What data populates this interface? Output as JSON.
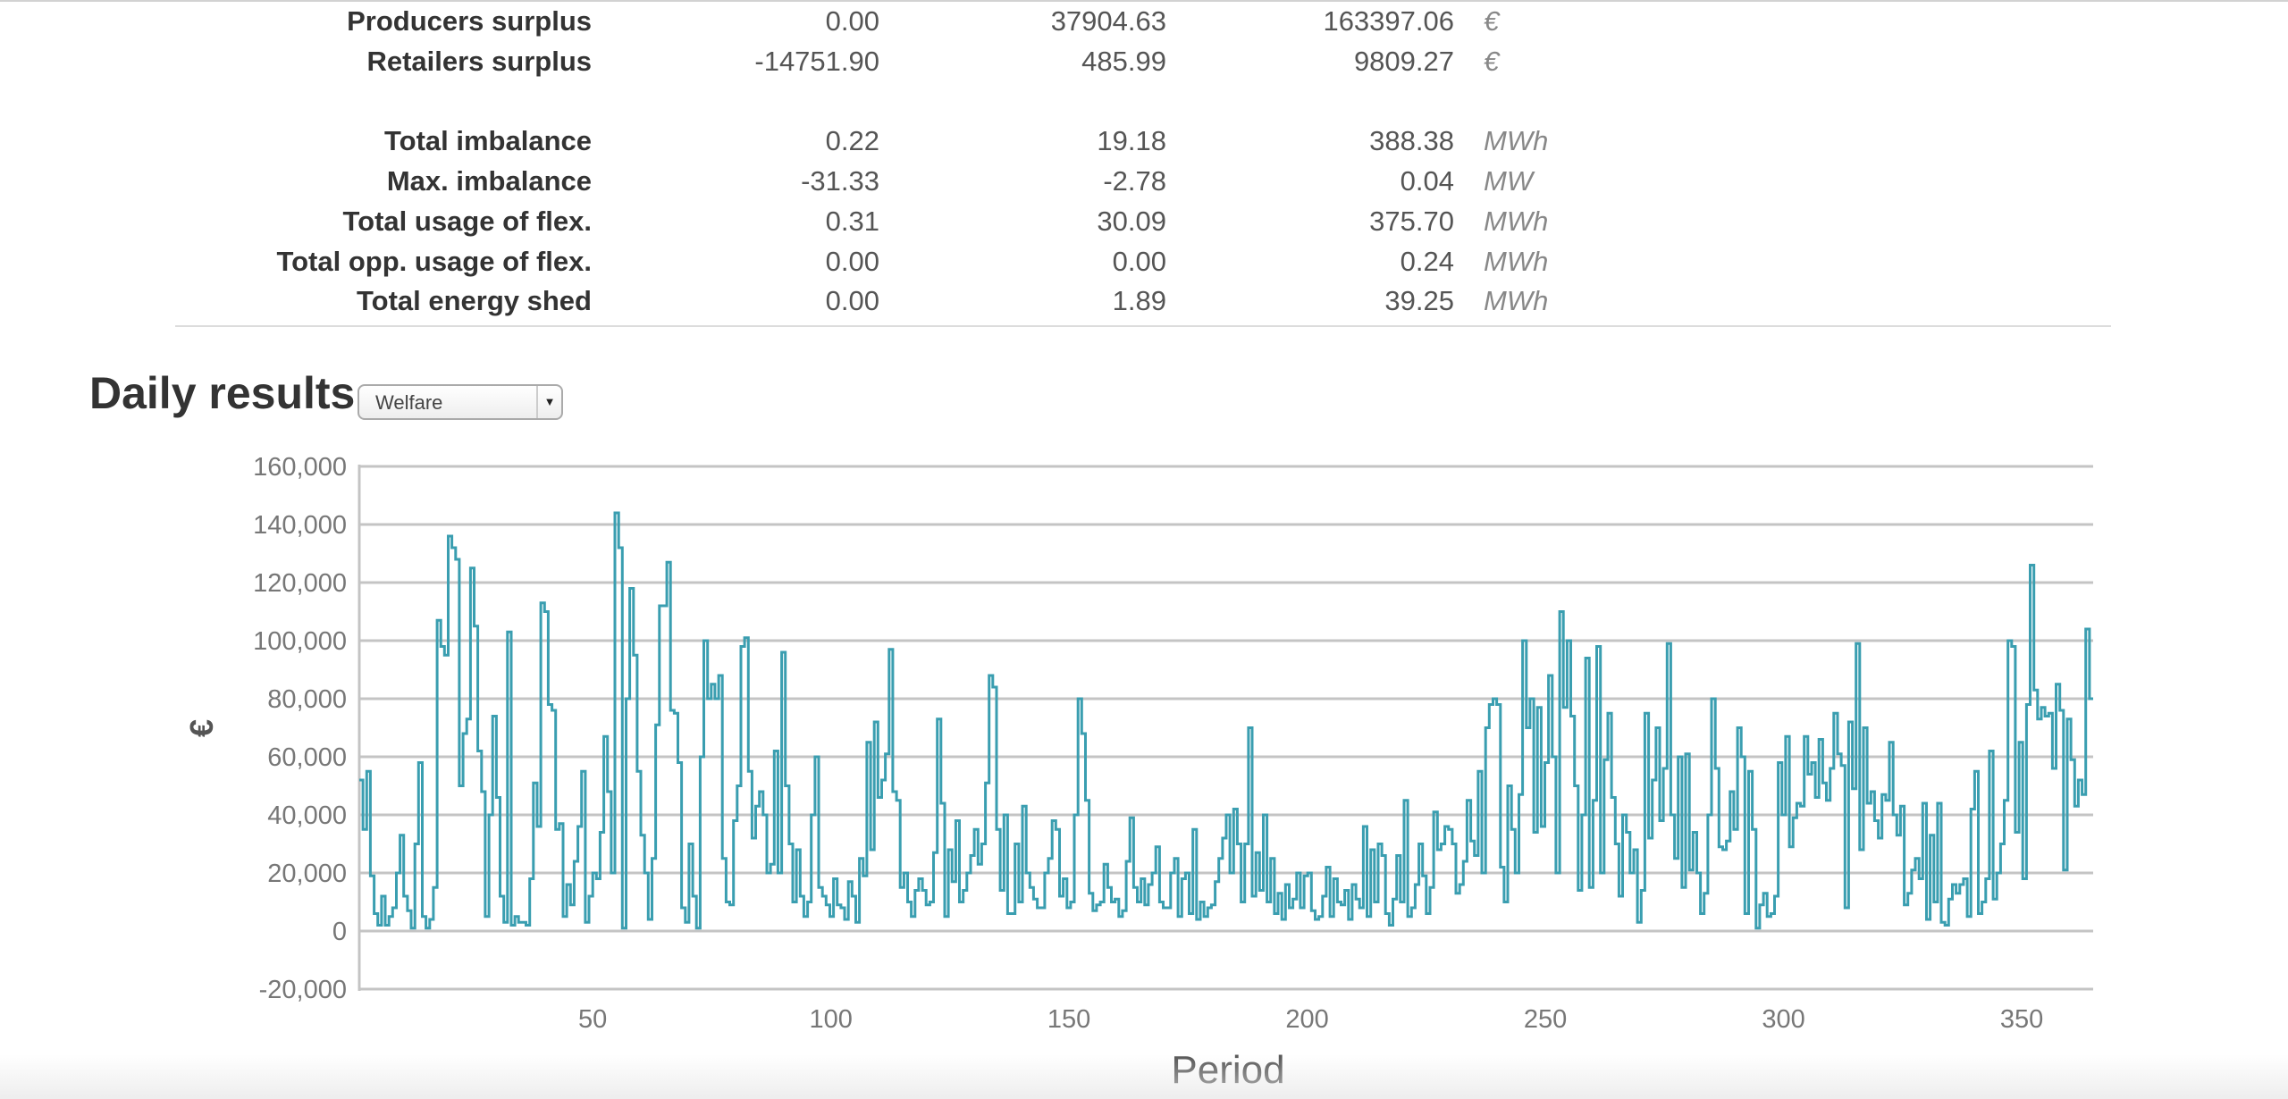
{
  "summary": {
    "rows": [
      {
        "label": "Producers surplus",
        "v1": "0.00",
        "v2": "37904.63",
        "v3": "163397.06",
        "unit": "€"
      },
      {
        "label": "Retailers surplus",
        "v1": "-14751.90",
        "v2": "485.99",
        "v3": "9809.27",
        "unit": "€"
      },
      {
        "label": "Total imbalance",
        "v1": "0.22",
        "v2": "19.18",
        "v3": "388.38",
        "unit": "MWh"
      },
      {
        "label": "Max. imbalance",
        "v1": "-31.33",
        "v2": "-2.78",
        "v3": "0.04",
        "unit": "MW"
      },
      {
        "label": "Total usage of flex.",
        "v1": "0.31",
        "v2": "30.09",
        "v3": "375.70",
        "unit": "MWh"
      },
      {
        "label": "Total opp. usage of flex.",
        "v1": "0.00",
        "v2": "0.00",
        "v3": "0.24",
        "unit": "MWh"
      },
      {
        "label": "Total energy shed",
        "v1": "0.00",
        "v2": "1.89",
        "v3": "39.25",
        "unit": "MWh"
      }
    ]
  },
  "daily": {
    "title": "Daily results",
    "select_value": "Welfare"
  },
  "chart_data": {
    "type": "line",
    "step": true,
    "xlabel": "Period",
    "ylabel": "€",
    "xlim": [
      1,
      365
    ],
    "ylim": [
      -20000,
      160000
    ],
    "xticks": [
      50,
      100,
      150,
      200,
      250,
      300,
      350
    ],
    "xtick_labels": [
      "50",
      "100",
      "150",
      "200",
      "250",
      "300",
      "350"
    ],
    "yticks": [
      -20000,
      0,
      20000,
      40000,
      60000,
      80000,
      100000,
      120000,
      140000,
      160000
    ],
    "ytick_labels": [
      "-20,000",
      "0",
      "20,000",
      "40,000",
      "60,000",
      "80,000",
      "100,000",
      "120,000",
      "140,000",
      "160,000"
    ],
    "grid": "horizontal",
    "line_color": "#3a9eb0",
    "series": [
      {
        "values": [
          52000,
          35000,
          55000,
          19000,
          6000,
          2000,
          12000,
          2000,
          5000,
          8000,
          20000,
          33000,
          12000,
          7000,
          1000,
          30000,
          58000,
          5000,
          1000,
          4000,
          15000,
          107000,
          98000,
          95000,
          136000,
          132000,
          128000,
          50000,
          68000,
          73000,
          125000,
          105000,
          62000,
          48000,
          5000,
          40000,
          74000,
          46000,
          12000,
          3000,
          103000,
          2000,
          5000,
          3000,
          3000,
          2000,
          18000,
          51000,
          36000,
          113000,
          110000,
          78000,
          76000,
          35000,
          37000,
          5000,
          16000,
          9000,
          24000,
          36000,
          55000,
          3000,
          12000,
          20000,
          18000,
          34000,
          67000,
          48000,
          20000,
          144000,
          132000,
          1000,
          80000,
          118000,
          95000,
          55000,
          33000,
          20000,
          4000,
          25000,
          71000,
          112000,
          112000,
          127000,
          76000,
          75000,
          58000,
          8000,
          3000,
          30000,
          12000,
          1000,
          60000,
          100000,
          80000,
          85000,
          80000,
          88000,
          25000,
          10000,
          9000,
          38000,
          50000,
          98000,
          101000,
          55000,
          32000,
          43000,
          48000,
          40000,
          20000,
          23000,
          62000,
          20000,
          96000,
          50000,
          30000,
          10000,
          28000,
          12000,
          5000,
          10000,
          40000,
          60000,
          15000,
          12000,
          9000,
          5000,
          18000,
          9000,
          8000,
          4000,
          17000,
          12000,
          3000,
          25000,
          19000,
          65000,
          28000,
          72000,
          46000,
          52000,
          61000,
          97000,
          48000,
          45000,
          15000,
          20000,
          10000,
          5000,
          14000,
          18000,
          14000,
          9000,
          10000,
          27000,
          73000,
          44000,
          5000,
          28000,
          17000,
          38000,
          10000,
          14000,
          20000,
          26000,
          35000,
          23000,
          30000,
          51000,
          88000,
          84000,
          35000,
          14000,
          40000,
          6000,
          6000,
          30000,
          10000,
          43000,
          20000,
          15000,
          11000,
          8000,
          8000,
          20000,
          25000,
          38000,
          35000,
          12000,
          18000,
          8000,
          10000,
          40000,
          80000,
          68000,
          45000,
          13000,
          7000,
          9000,
          10000,
          23000,
          15000,
          10000,
          11000,
          5000,
          7000,
          24000,
          39000,
          15000,
          10000,
          18000,
          9000,
          16000,
          20000,
          29000,
          10000,
          8000,
          8000,
          20000,
          25000,
          5000,
          18000,
          20000,
          6000,
          35000,
          4000,
          10000,
          5000,
          8000,
          9000,
          17000,
          25000,
          32000,
          40000,
          20000,
          42000,
          30000,
          10000,
          30000,
          70000,
          12000,
          27000,
          14000,
          40000,
          10000,
          25000,
          6000,
          13000,
          4000,
          16000,
          8000,
          11000,
          20000,
          8000,
          19000,
          20000,
          7000,
          4000,
          5000,
          12000,
          22000,
          5000,
          18000,
          10000,
          9000,
          14000,
          4000,
          16000,
          11000,
          8000,
          36000,
          5000,
          28000,
          10000,
          30000,
          26000,
          6000,
          2000,
          11000,
          26000,
          10000,
          45000,
          5000,
          8000,
          16000,
          30000,
          19000,
          6000,
          15000,
          41000,
          28000,
          30000,
          36000,
          35000,
          30000,
          13000,
          16000,
          24000,
          45000,
          31000,
          26000,
          55000,
          20000,
          70000,
          78000,
          80000,
          78000,
          22000,
          10000,
          50000,
          35000,
          20000,
          47000,
          100000,
          70000,
          80000,
          34000,
          77000,
          36000,
          58000,
          88000,
          60000,
          20000,
          110000,
          77000,
          100000,
          74000,
          50000,
          14000,
          40000,
          94000,
          15000,
          45000,
          98000,
          20000,
          59000,
          75000,
          46000,
          30000,
          12000,
          40000,
          34000,
          20000,
          28000,
          3000,
          14000,
          75000,
          32000,
          52000,
          70000,
          38000,
          56000,
          99000,
          40000,
          25000,
          60000,
          15000,
          61000,
          21000,
          34000,
          20000,
          6000,
          13000,
          40000,
          80000,
          56000,
          29000,
          28000,
          31000,
          48000,
          35000,
          70000,
          60000,
          6000,
          55000,
          35000,
          1000,
          9000,
          13000,
          5000,
          6000,
          12000,
          58000,
          40000,
          67000,
          29000,
          39000,
          44000,
          43000,
          67000,
          54000,
          58000,
          46000,
          66000,
          51000,
          45000,
          56000,
          75000,
          61000,
          57000,
          8000,
          72000,
          49000,
          99000,
          28000,
          70000,
          44000,
          48000,
          38000,
          32000,
          47000,
          45000,
          65000,
          40000,
          33000,
          43000,
          9000,
          13000,
          21000,
          25000,
          18000,
          44000,
          4000,
          33000,
          10000,
          44000,
          3000,
          2000,
          11000,
          16000,
          13000,
          16000,
          18000,
          5000,
          42000,
          55000,
          6000,
          10000,
          18000,
          62000,
          11000,
          20000,
          30000,
          45000,
          100000,
          98000,
          34000,
          65000,
          18000,
          78000,
          126000,
          83000,
          73000,
          77000,
          74000,
          75000,
          56000,
          85000,
          76000,
          21000,
          73000,
          59000,
          43000,
          52000,
          47000,
          104000,
          80000
        ]
      }
    ]
  }
}
